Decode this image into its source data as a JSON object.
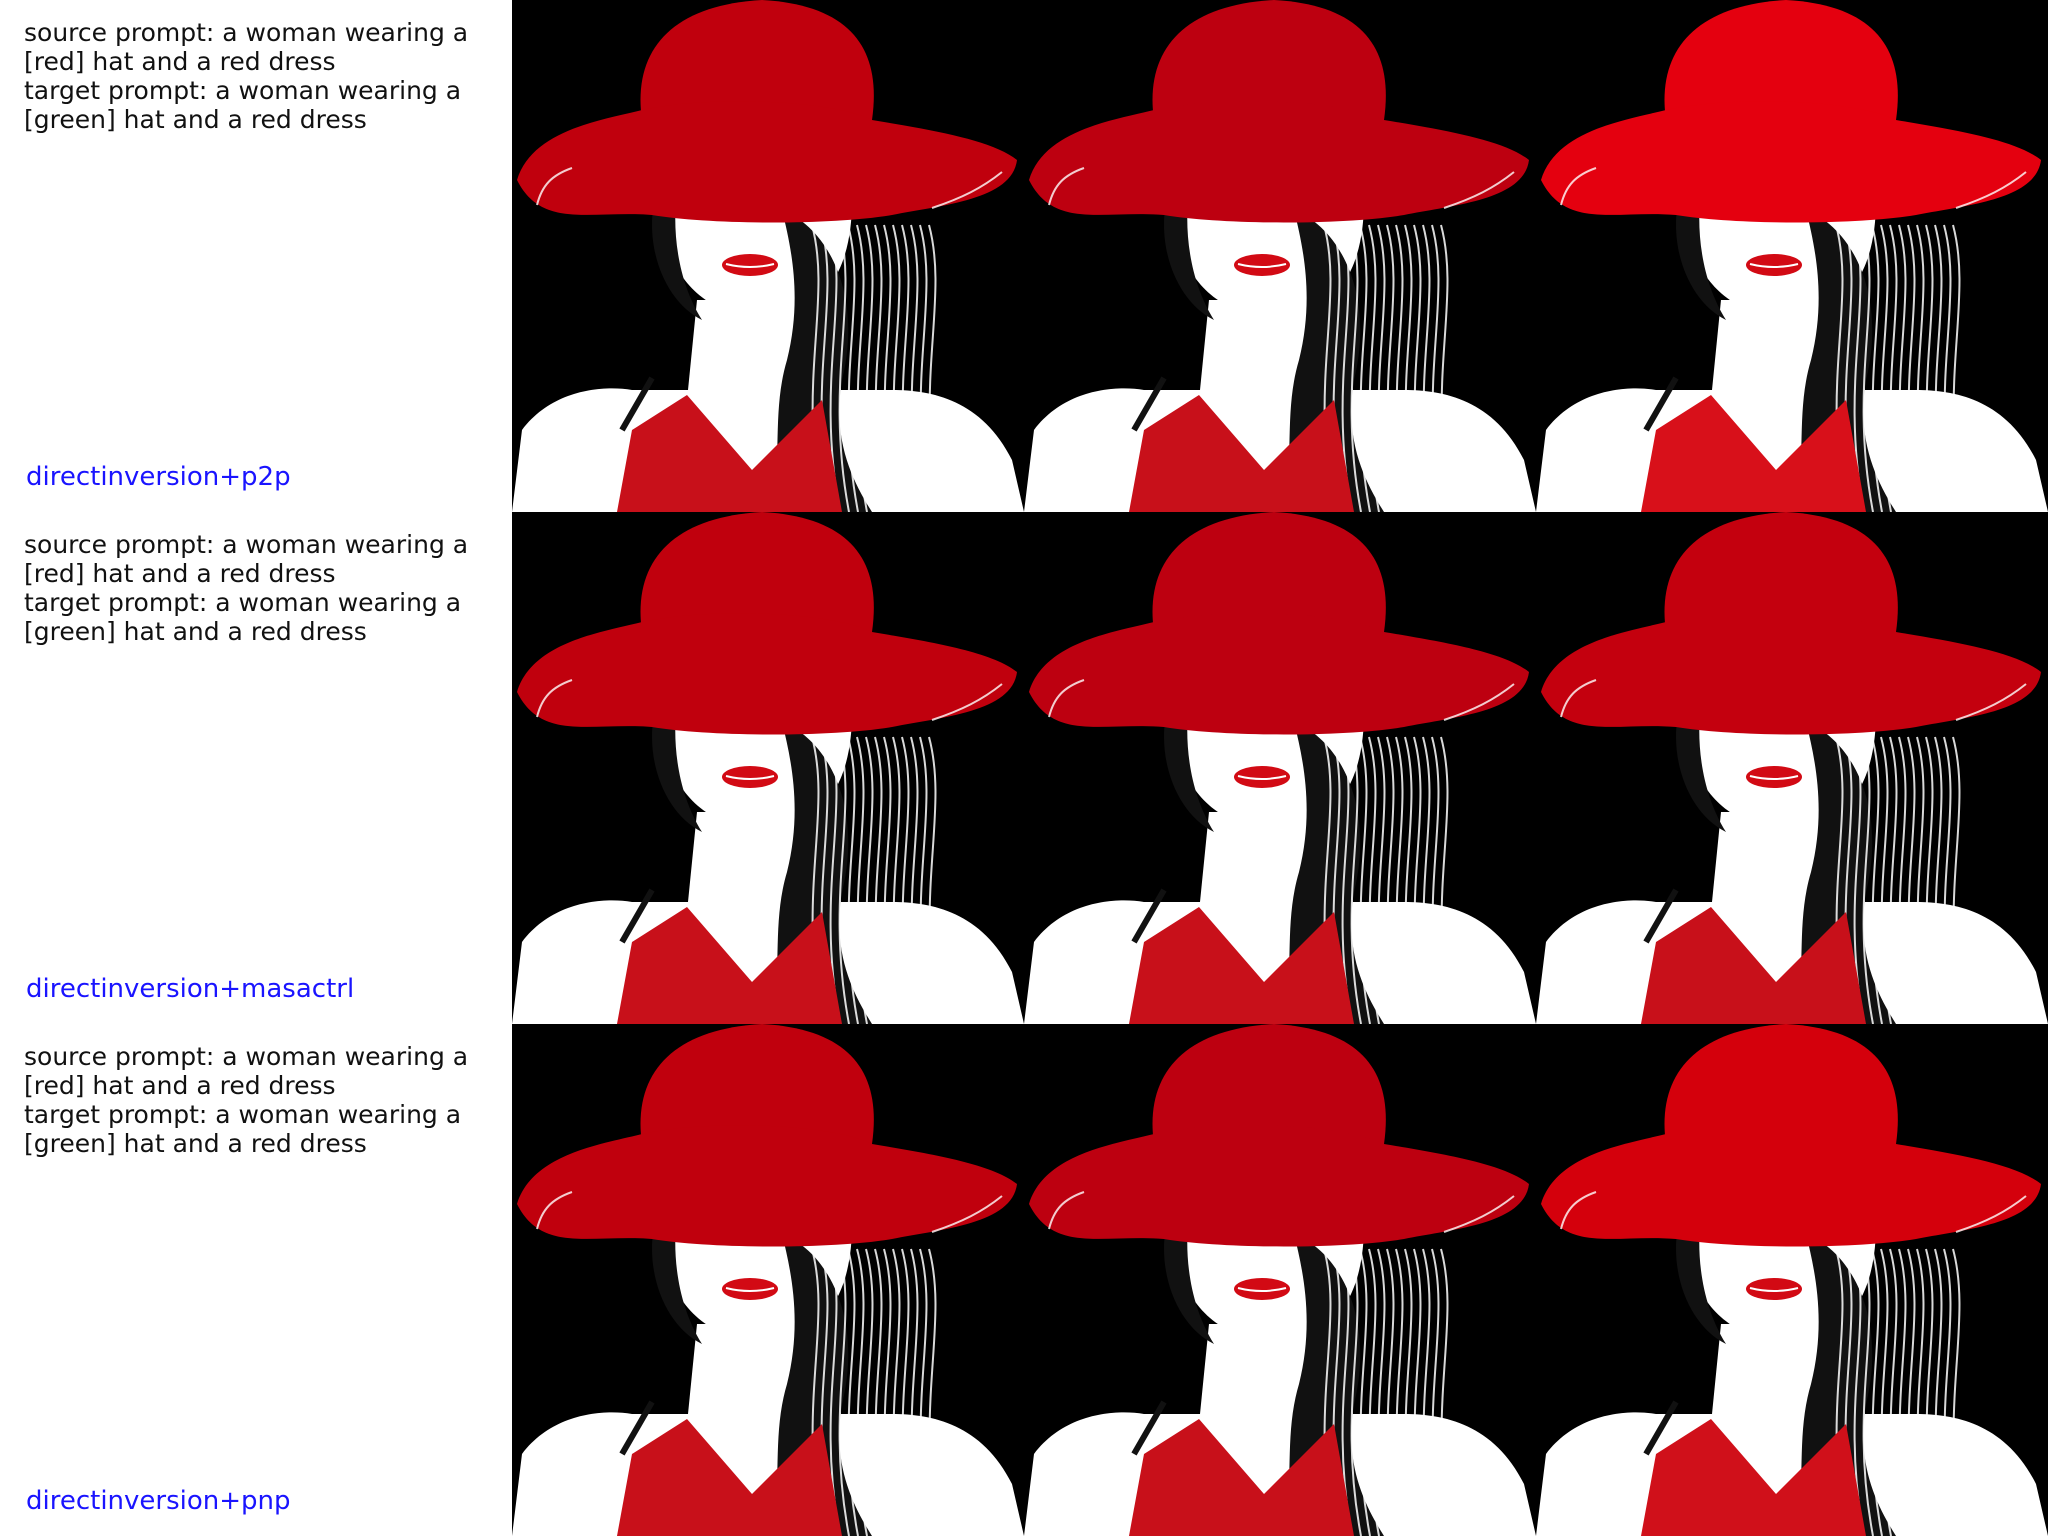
{
  "rows": [
    {
      "source_prompt": "source prompt: a woman wearing a [red] hat and a red dress",
      "target_prompt": "target prompt: a woman wearing a [green] hat and a red dress",
      "method": "directinversion+p2p",
      "tile_colors": {
        "hat": [
          "#c0000d",
          "#bd0010",
          "#e4000f"
        ],
        "dress": [
          "#c8101a",
          "#c8101a",
          "#d8101a"
        ]
      }
    },
    {
      "source_prompt": "source prompt: a woman wearing a [red] hat and a red dress",
      "target_prompt": "target prompt: a woman wearing a [green] hat and a red dress",
      "method": "directinversion+masactrl",
      "tile_colors": {
        "hat": [
          "#c0000d",
          "#bd0010",
          "#c4000e"
        ],
        "dress": [
          "#c8101a",
          "#c8101a",
          "#c8101a"
        ]
      }
    },
    {
      "source_prompt": "source prompt: a woman wearing a [red] hat and a red dress",
      "target_prompt": "target prompt: a woman wearing a [green] hat and a red dress",
      "method": "directinversion+pnp",
      "tile_colors": {
        "hat": [
          "#c0000d",
          "#bd0010",
          "#d4000c"
        ],
        "dress": [
          "#c8101a",
          "#c8101a",
          "#d0101a"
        ]
      }
    }
  ],
  "colors": {
    "background": "#000000",
    "skin": "#ffffff",
    "hair": "#111111",
    "lips": "#d20a14",
    "label_blue": "#1a14ff"
  }
}
